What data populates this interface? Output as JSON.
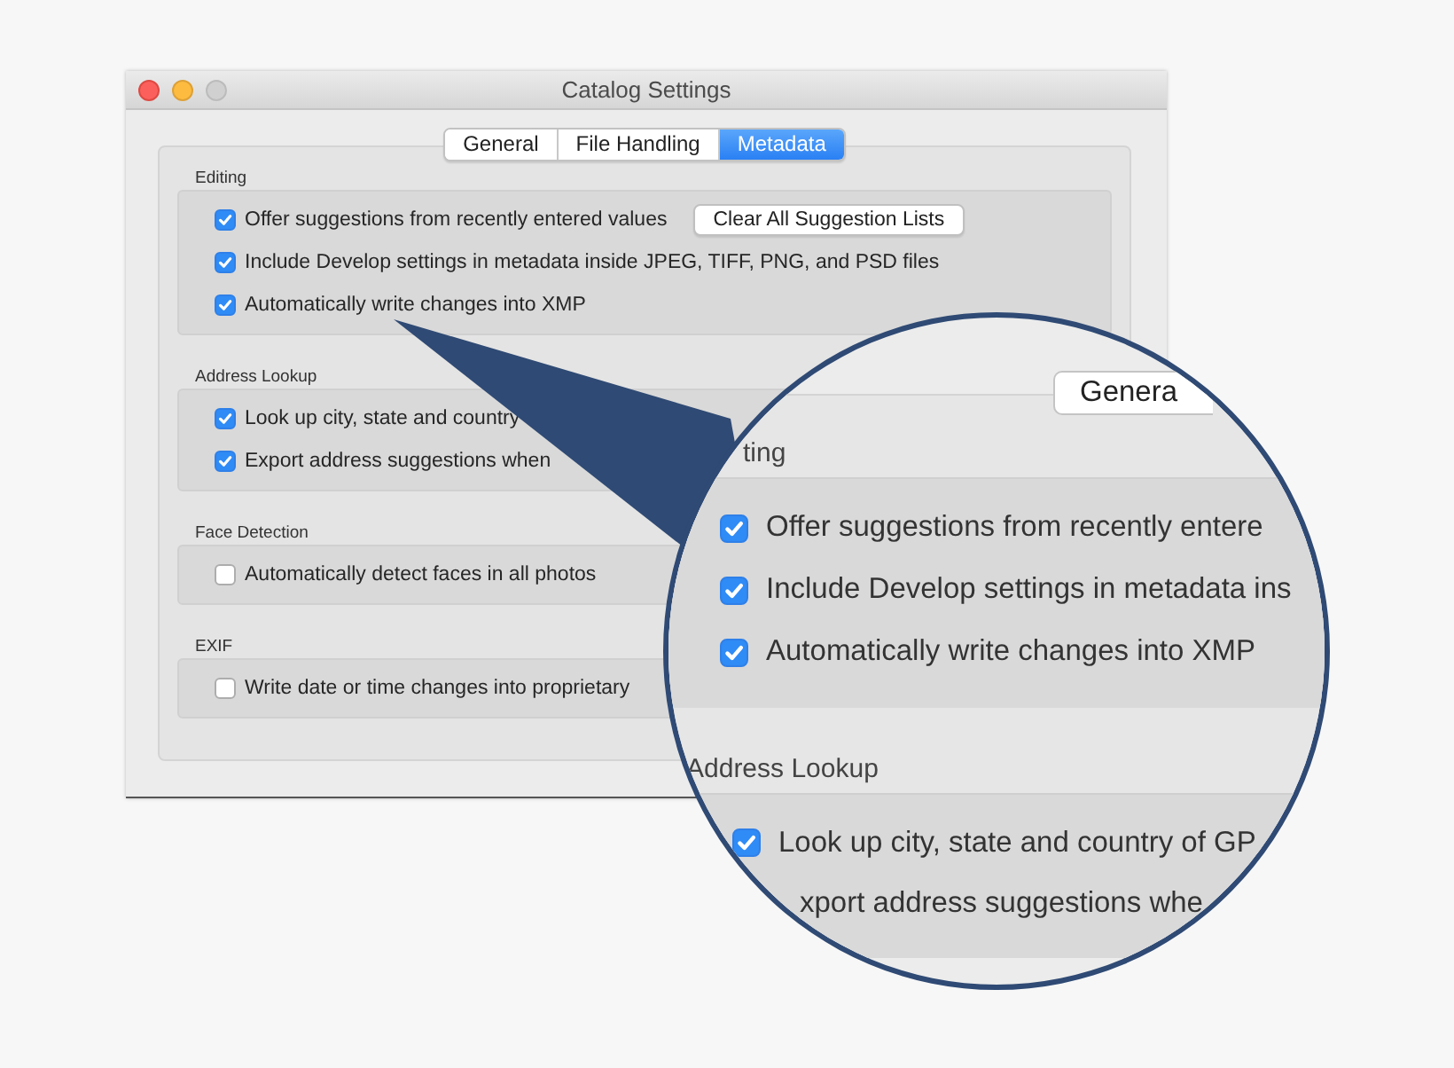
{
  "window": {
    "title": "Catalog Settings",
    "controls": [
      {
        "kind": "close"
      },
      {
        "kind": "minimize"
      },
      {
        "kind": "zoom"
      }
    ]
  },
  "tabs": [
    {
      "label": "General",
      "selected": false
    },
    {
      "label": "File Handling",
      "selected": false
    },
    {
      "label": "Metadata",
      "selected": true
    }
  ],
  "sections": [
    {
      "title": "Editing",
      "options": [
        {
          "label": "Offer suggestions from recently entered values",
          "checked": true,
          "button": "Clear All Suggestion Lists"
        },
        {
          "label": "Include Develop settings in metadata inside JPEG, TIFF, PNG, and PSD files",
          "checked": true
        },
        {
          "label": "Automatically write changes into XMP",
          "checked": true
        }
      ]
    },
    {
      "title": "Address Lookup",
      "options": [
        {
          "label": "Look up city, state and country",
          "checked": true
        },
        {
          "label": "Export address suggestions when",
          "checked": true
        }
      ]
    },
    {
      "title": "Face Detection",
      "options": [
        {
          "label": "Automatically detect faces in all photos",
          "checked": false
        }
      ]
    },
    {
      "title": "EXIF",
      "options": [
        {
          "label": "Write date or time changes into proprietary",
          "checked": false
        }
      ]
    }
  ],
  "magnifier": {
    "tabs": [
      {
        "label": "Genera",
        "selected": false
      }
    ],
    "sections": [
      {
        "title": "ting",
        "options": [
          {
            "kind": "checkbox",
            "label": "Offer suggestions from recently entere",
            "checked": true
          },
          {
            "kind": "checkbox",
            "label": "Include Develop settings in metadata ins",
            "checked": true
          },
          {
            "kind": "checkbox",
            "label": "Automatically write changes into XMP",
            "checked": true
          }
        ]
      },
      {
        "title": "Address Lookup",
        "options": [
          {
            "kind": "checkbox",
            "label": "Look up city, state and country of GP",
            "checked": true
          },
          {
            "kind": "text",
            "label": "xport address suggestions whe"
          }
        ]
      }
    ]
  }
}
